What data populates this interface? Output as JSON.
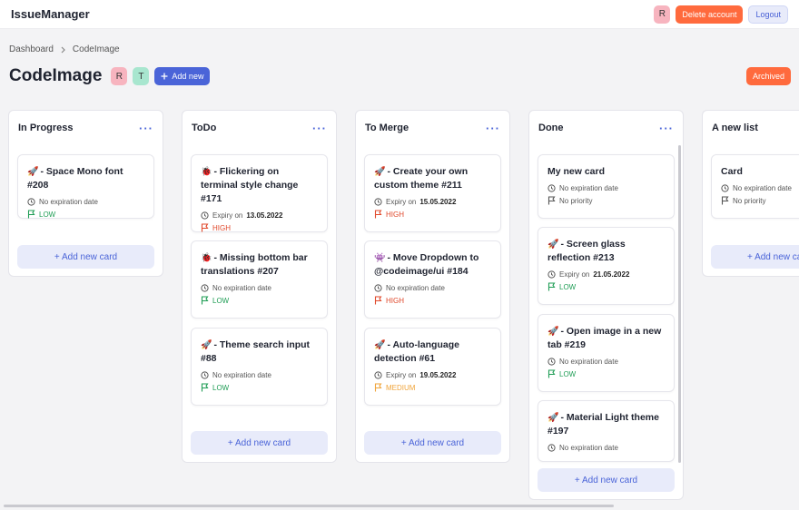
{
  "app": {
    "title": "IssueManager"
  },
  "header": {
    "avatar": "R",
    "delete_label": "Delete account",
    "logout_label": "Logout"
  },
  "breadcrumb": [
    "Dashboard",
    "CodeImage"
  ],
  "project": {
    "title": "CodeImage",
    "members": [
      "R",
      "T"
    ],
    "add_label": "Add new",
    "archived_label": "Archived"
  },
  "columns": [
    {
      "title": "In Progress",
      "add_label": "+ Add new card",
      "cards": [
        {
          "emoji": "🚀",
          "title": "- Space Mono font #208",
          "date_label": "No expiration date",
          "date": "",
          "priority": "LOW"
        }
      ]
    },
    {
      "title": "ToDo",
      "add_label": "+ Add new card",
      "cards": [
        {
          "emoji": "🐞",
          "title": "- Flickering on terminal style change #171",
          "date_label": "Expiry on",
          "date": "13.05.2022",
          "priority": "HIGH"
        },
        {
          "emoji": "🐞",
          "title": "- Missing bottom bar translations #207",
          "date_label": "No expiration date",
          "date": "",
          "priority": "LOW"
        },
        {
          "emoji": "🚀",
          "title": "- Theme search input #88",
          "date_label": "No expiration date",
          "date": "",
          "priority": "LOW"
        }
      ]
    },
    {
      "title": "To Merge",
      "add_label": "+ Add new card",
      "cards": [
        {
          "emoji": "🚀",
          "title": "- Create your own custom theme #211",
          "date_label": "Expiry on",
          "date": "15.05.2022",
          "priority": "HIGH"
        },
        {
          "emoji": "👾",
          "title": "- Move Dropdown to @codeimage/ui #184",
          "date_label": "No expiration date",
          "date": "",
          "priority": "HIGH"
        },
        {
          "emoji": "🚀",
          "title": "- Auto-language detection #61",
          "date_label": "Expiry on",
          "date": "19.05.2022",
          "priority": "MEDIUM"
        }
      ]
    },
    {
      "title": "Done",
      "add_label": "+ Add new card",
      "cards": [
        {
          "emoji": "",
          "title": "My new card",
          "date_label": "No expiration date",
          "date": "",
          "priority": "No priority"
        },
        {
          "emoji": "🚀",
          "title": "- Screen glass reflection #213",
          "date_label": "Expiry on",
          "date": "21.05.2022",
          "priority": "LOW"
        },
        {
          "emoji": "🚀",
          "title": "- Open image in a new tab #219",
          "date_label": "No expiration date",
          "date": "",
          "priority": "LOW"
        },
        {
          "emoji": "🚀",
          "title": "- Material Light theme #197",
          "date_label": "No expiration date",
          "date": "",
          "priority": ""
        }
      ]
    },
    {
      "title": "A new list",
      "add_label": "+ Add new card",
      "cards": [
        {
          "emoji": "",
          "title": "Card",
          "date_label": "No expiration date",
          "date": "",
          "priority": "No priority"
        }
      ]
    }
  ],
  "colors": {
    "accent": "#4a64d8",
    "danger": "#ff6a3d",
    "low": "#1f9d55",
    "high": "#e0482b",
    "medium": "#f0a43a"
  },
  "icons": {
    "more": "more-horizontal-icon",
    "clock": "clock-icon",
    "flag": "flag-icon",
    "chevron": "chevron-right-icon",
    "plus": "plus-icon"
  }
}
